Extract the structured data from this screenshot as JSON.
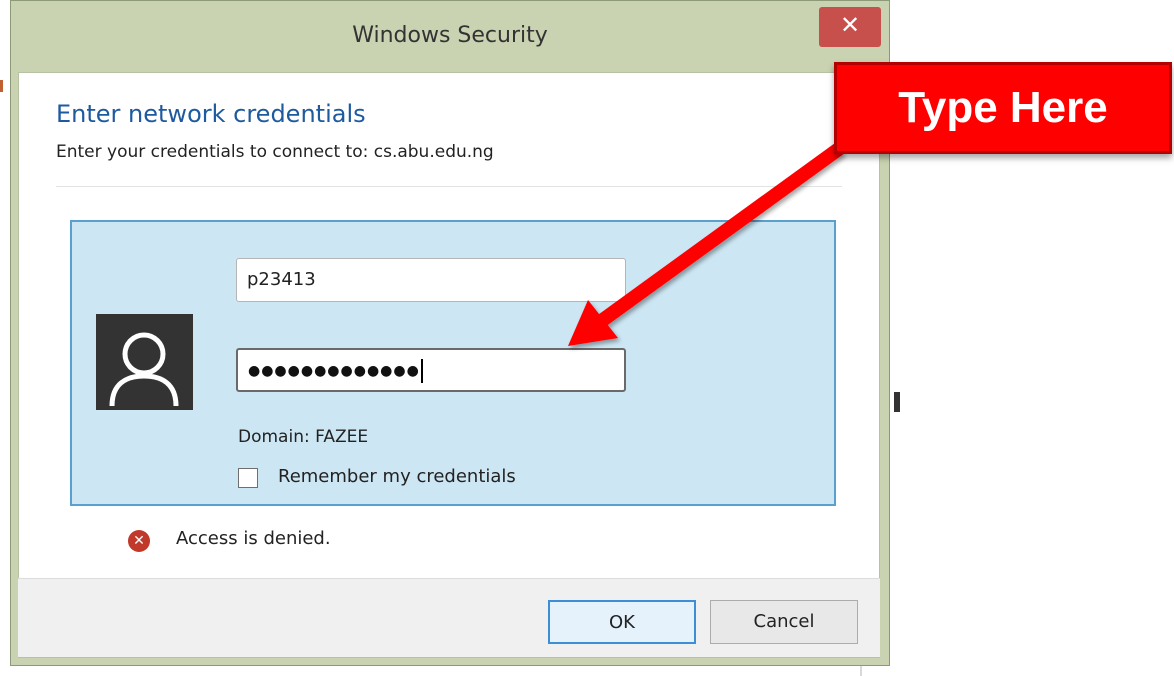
{
  "window": {
    "title": "Windows Security",
    "close_symbol": "✕"
  },
  "dialog": {
    "heading": "Enter network credentials",
    "subheading": "Enter your credentials to connect to: cs.abu.edu.ng"
  },
  "credentials": {
    "username_value": "p23413",
    "password_mask": "●●●●●●●●●●●●●",
    "domain_label": "Domain: FAZEE",
    "remember_label": "Remember my credentials",
    "remember_checked": false
  },
  "error": {
    "message": "Access is denied."
  },
  "buttons": {
    "ok_label": "OK",
    "cancel_label": "Cancel"
  },
  "annotation": {
    "callout_text": "Type Here",
    "color": "#ff0000"
  },
  "colors": {
    "heading": "#1e5aa0",
    "panel_bg": "#cce6f3",
    "panel_border": "#5aa0cf",
    "close_button": "#c7504c"
  },
  "icons": {
    "avatar": "user-avatar-icon",
    "error": "error-x-icon",
    "close": "close-icon"
  }
}
